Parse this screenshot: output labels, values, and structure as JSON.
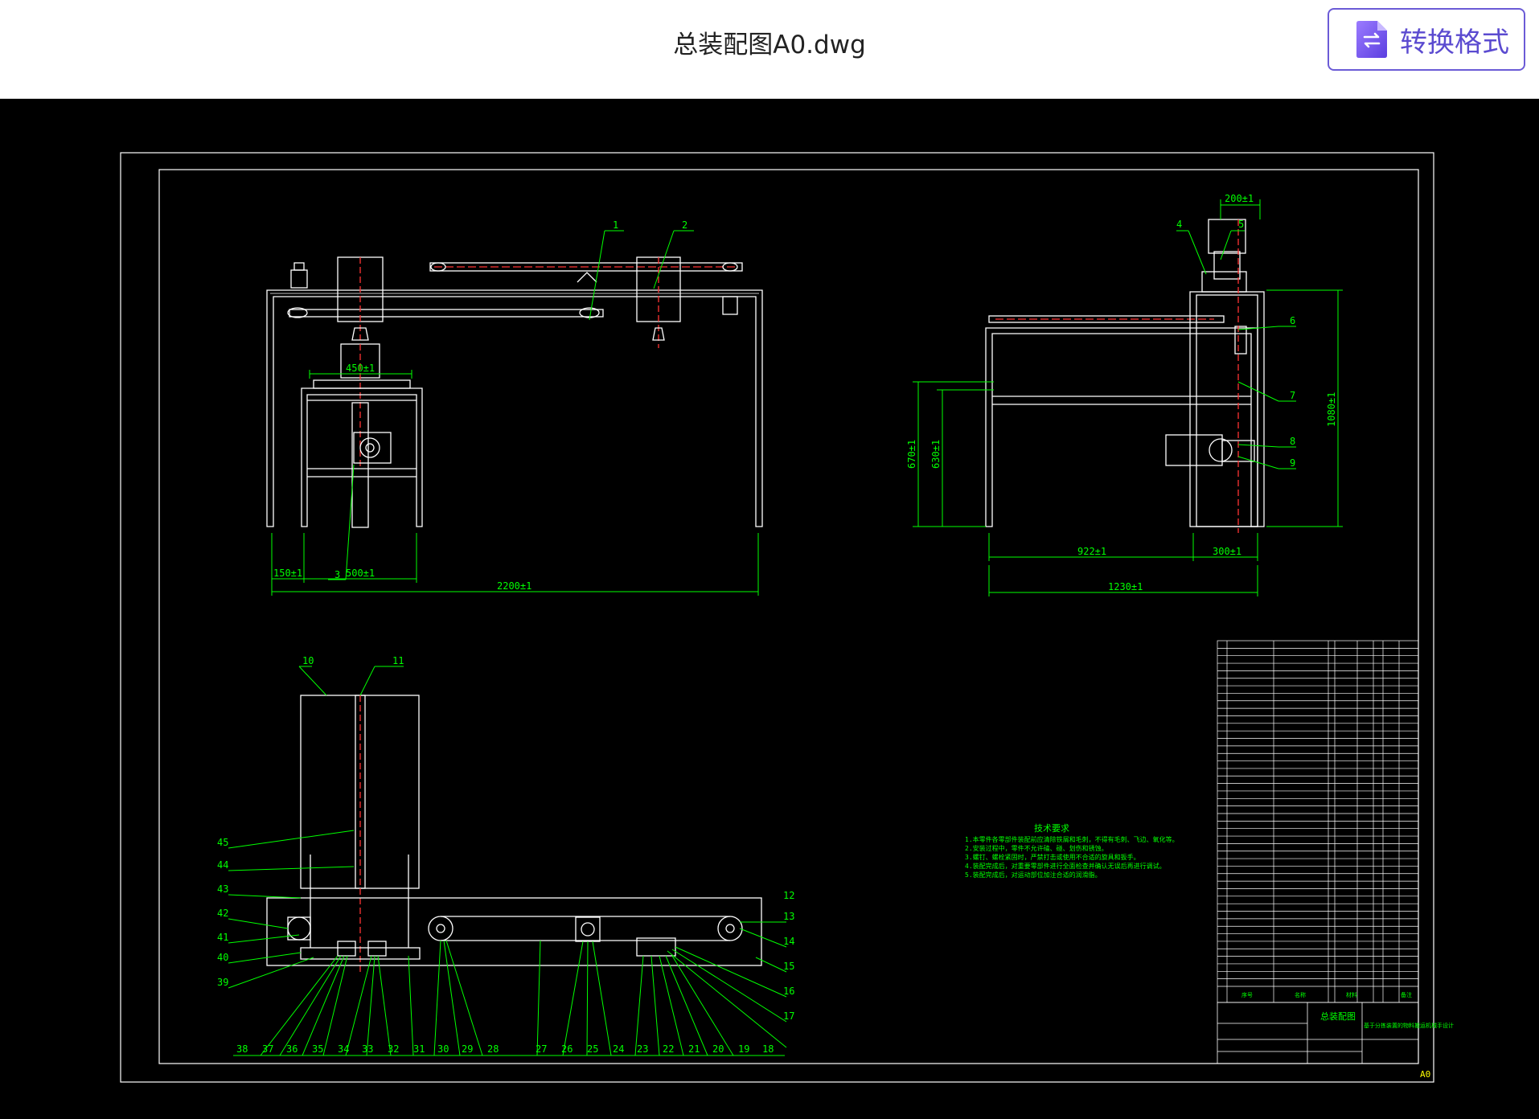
{
  "header": {
    "file_title": "总装配图A0.dwg",
    "convert_label": "转换格式",
    "convert_icon": "document-swap-icon"
  },
  "drawing": {
    "sheet_size": "A0",
    "front_view_dims": {
      "top_block": "450±1",
      "overall": "2200±1",
      "left_offset": "150±1",
      "table_width": "500±1"
    },
    "side_view_dims": {
      "top": "200±1",
      "height_total": "1080±1",
      "h1": "670±1",
      "h2": "630±1",
      "w1": "922±1",
      "w2": "300±1",
      "overall": "1230±1"
    },
    "front_balloons": [
      "1",
      "2",
      "3"
    ],
    "side_balloons": [
      "4",
      "5",
      "6",
      "7",
      "8",
      "9"
    ],
    "plan_balloons_left": [
      "45",
      "44",
      "43",
      "42",
      "41",
      "40",
      "39"
    ],
    "plan_balloons_top": [
      "10",
      "11"
    ],
    "plan_balloons_right": [
      "12",
      "13",
      "14",
      "15",
      "16",
      "17",
      "18"
    ],
    "plan_balloons_bottom": [
      "38",
      "37",
      "36",
      "35",
      "34",
      "33",
      "32",
      "31",
      "30",
      "29",
      "28",
      "27",
      "26",
      "25",
      "24",
      "23",
      "22",
      "21",
      "20",
      "19"
    ],
    "tech_requirements": {
      "title": "技术要求",
      "lines": [
        "1.本零件各零部件装配前应清除铁屑和毛刺，不得有毛刺、飞边、氧化等。",
        "2.安装过程中，零件不允许磕、碰、划伤和锈蚀。",
        "3.螺钉、螺栓紧固时，严禁打击或使用不合适的旋具和扳手。",
        "4.装配完成后，对重要零部件进行全面检查并确认无误后再进行调试。",
        "5.装配完成后，对运动部位加注合适的润滑脂。"
      ]
    },
    "title_block": {
      "drawing_name": "总装配图",
      "project": "基于分拣装置的物料搬运机械手设计",
      "col_no": "序号",
      "col_name": "名称",
      "col_material": "材料",
      "col_remark": "备注"
    }
  },
  "colors": {
    "line": "#ffffff",
    "dim": "#00ff00",
    "center": "#ff2020",
    "accent": "#6b5bd6"
  }
}
